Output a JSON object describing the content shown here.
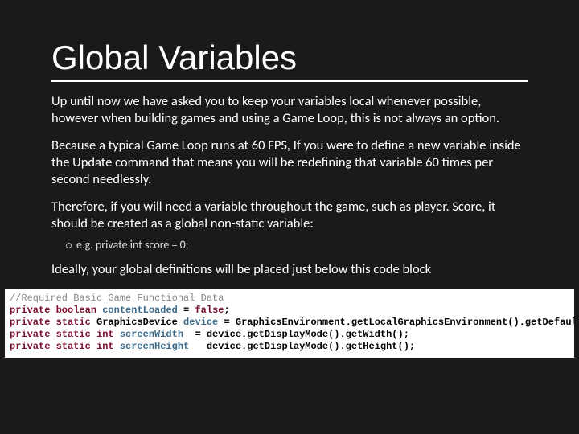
{
  "title": "Global Variables",
  "para1": "Up until now we have asked you to keep your variables local whenever possible, however when building games and using a Game Loop, this is not always an option.",
  "para2": "Because a typical Game Loop runs at 60 FPS, If you were to define a new variable inside the Update command that means you will be redefining that variable 60 times per second needlessly.",
  "para3": "Therefore, if you will need a variable throughout the game, such as player. Score, it should be created as a global non-static variable:",
  "bullet": "e.g. private int score = 0;",
  "para4": "Ideally, your global definitions will be placed just below this code block",
  "code": {
    "l1_comment": "//Required Basic Game Functional Data",
    "l2_kw": "private boolean",
    "l2_id": "contentLoaded",
    "l2_rest": " = ",
    "l2_val": "false",
    "l2_end": ";",
    "l3_kw": "private static",
    "l3_type": " GraphicsDevice ",
    "l3_id": "device",
    "l3_rest": " = GraphicsEnvironment.getLocalGraphicsEnvironment().getDefaultScreenDevice();",
    "l4_kw": "private static int",
    "l4_id": " screenWidth",
    "l4_rest": "  = device.getDisplayMode().getWidth();",
    "l5_kw": "private static int",
    "l5_id": " screenHeight",
    "l5_rest": "   device.getDisplayMode().getHeight();"
  }
}
